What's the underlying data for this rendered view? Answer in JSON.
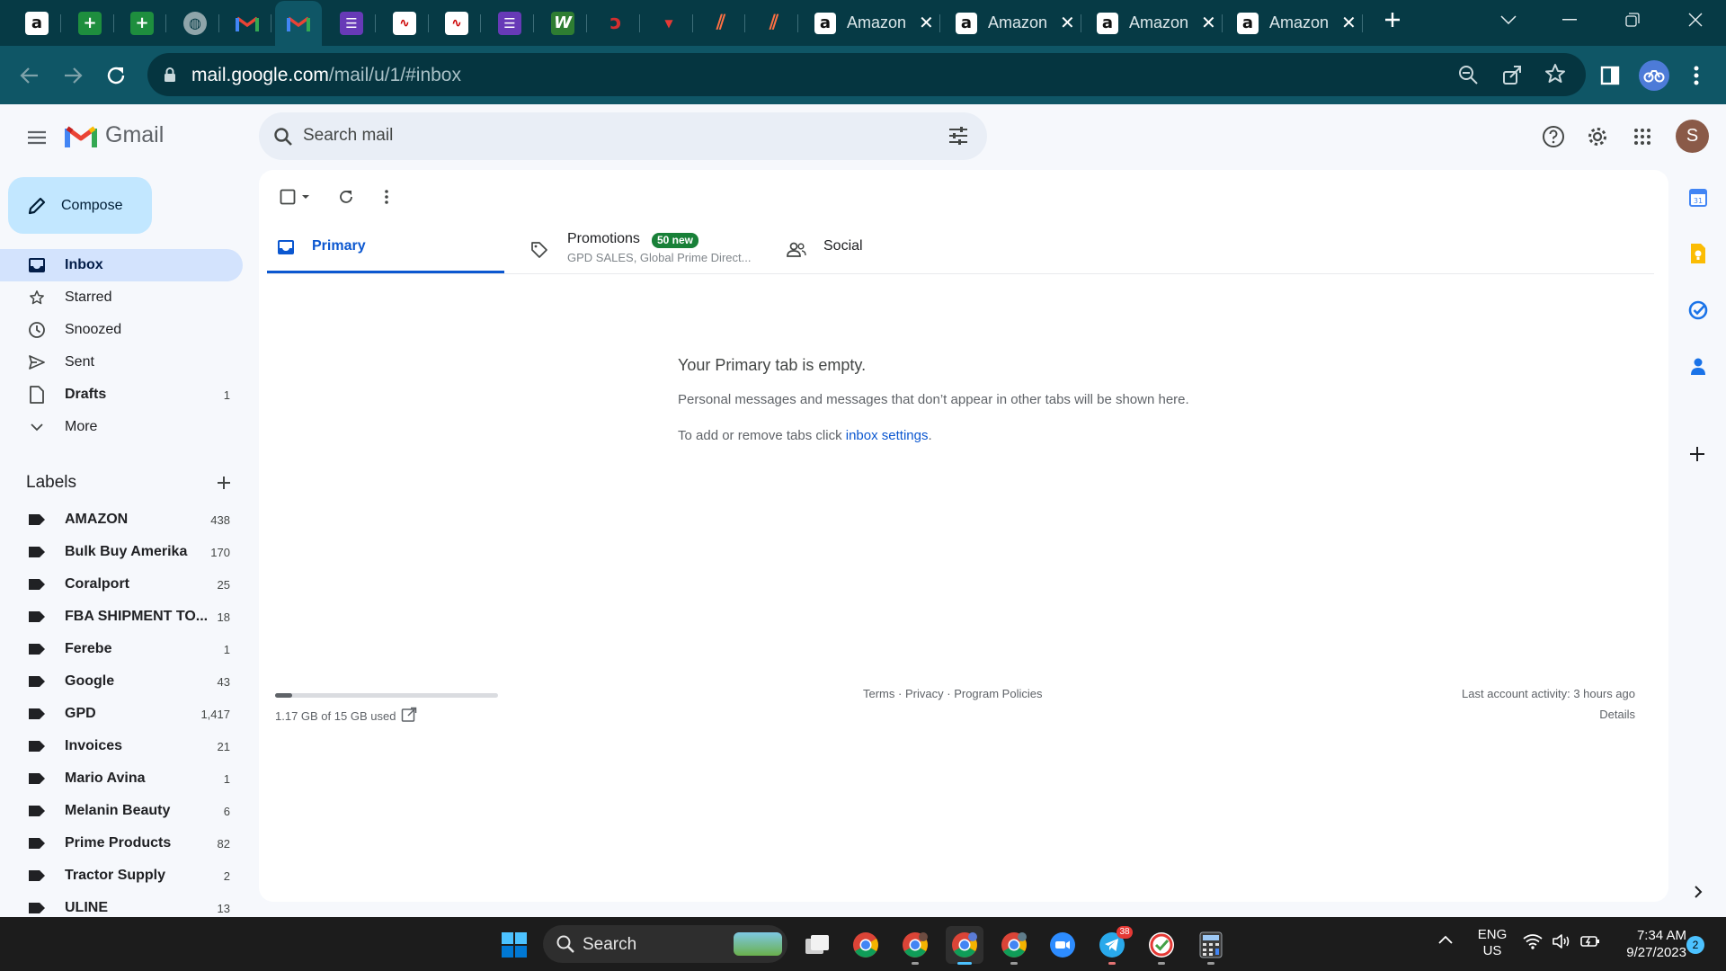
{
  "browser": {
    "pinned_tabs": [
      {
        "icon": "amazon-icon"
      },
      {
        "icon": "sheets-plus-icon"
      },
      {
        "icon": "sheets-plus-icon"
      },
      {
        "icon": "globe-icon"
      },
      {
        "icon": "gmail-icon"
      },
      {
        "icon": "gmail-icon"
      },
      {
        "icon": "forms-list-icon"
      },
      {
        "icon": "chart-doc-icon"
      },
      {
        "icon": "chart-doc-icon"
      },
      {
        "icon": "forms-list-icon"
      },
      {
        "icon": "w-logo-icon"
      },
      {
        "icon": "swoosh-icon"
      },
      {
        "icon": "red-logo-icon"
      },
      {
        "icon": "slash-logo-icon"
      },
      {
        "icon": "slash-logo-icon"
      }
    ],
    "named_tabs": [
      {
        "title": "Amazon",
        "icon": "amazon-icon"
      },
      {
        "title": "Amazon",
        "icon": "amazon-icon"
      },
      {
        "title": "Amazon",
        "icon": "amazon-icon"
      },
      {
        "title": "Amazon",
        "icon": "amazon-icon"
      }
    ],
    "url_host": "mail.google.com",
    "url_path": "/mail/u/1/#inbox"
  },
  "gmail": {
    "logo_text": "Gmail",
    "search_placeholder": "Search mail",
    "avatar_initial": "S",
    "compose_label": "Compose",
    "nav": [
      {
        "label": "Inbox",
        "count": "",
        "icon": "inbox-icon",
        "active": true
      },
      {
        "label": "Starred",
        "count": "",
        "icon": "star-icon"
      },
      {
        "label": "Snoozed",
        "count": "",
        "icon": "clock-icon"
      },
      {
        "label": "Sent",
        "count": "",
        "icon": "send-icon"
      },
      {
        "label": "Drafts",
        "count": "1",
        "icon": "draft-icon",
        "bold": true
      },
      {
        "label": "More",
        "count": "",
        "icon": "chevron-down-icon"
      }
    ],
    "labels_heading": "Labels",
    "labels": [
      {
        "label": "AMAZON",
        "count": "438"
      },
      {
        "label": "Bulk Buy Amerika",
        "count": "170"
      },
      {
        "label": "Coralport",
        "count": "25"
      },
      {
        "label": "FBA SHIPMENT TO...",
        "count": "18"
      },
      {
        "label": "Ferebe",
        "count": "1"
      },
      {
        "label": "Google",
        "count": "43"
      },
      {
        "label": "GPD",
        "count": "1,417"
      },
      {
        "label": "Invoices",
        "count": "21"
      },
      {
        "label": "Mario Avina",
        "count": "1"
      },
      {
        "label": "Melanin Beauty",
        "count": "6"
      },
      {
        "label": "Prime Products",
        "count": "82"
      },
      {
        "label": "Tractor Supply",
        "count": "2"
      },
      {
        "label": "ULINE",
        "count": "13"
      }
    ],
    "tabs": {
      "primary": "Primary",
      "promotions": "Promotions",
      "promotions_badge": "50 new",
      "promotions_senders": "GPD SALES, Global Prime Direct...",
      "social": "Social"
    },
    "empty": {
      "title": "Your Primary tab is empty.",
      "line1": "Personal messages and messages that don’t appear in other tabs will be shown here.",
      "line2_prefix": "To add or remove tabs click ",
      "line2_link": "inbox settings",
      "line2_suffix": "."
    },
    "footer": {
      "storage_text": "1.17 GB of 15 GB used",
      "storage_fraction": 0.078,
      "terms": "Terms",
      "privacy": "Privacy",
      "policies": "Program Policies",
      "dot": "·",
      "activity": "Last account activity: 3 hours ago",
      "details": "Details"
    }
  },
  "taskbar": {
    "search_placeholder": "Search",
    "lang_line1": "ENG",
    "lang_line2": "US",
    "time": "7:34 AM",
    "date": "9/27/2023",
    "notification_count": "2",
    "telegram_badge": "38"
  },
  "colors": {
    "tabstrip_bg": "#063a45",
    "toolbar_bg": "#0f5666",
    "compose_bg": "#c2e7ff",
    "active_nav_bg": "#d3e3fd",
    "accent": "#0b57d0",
    "badge_green": "#188038"
  }
}
